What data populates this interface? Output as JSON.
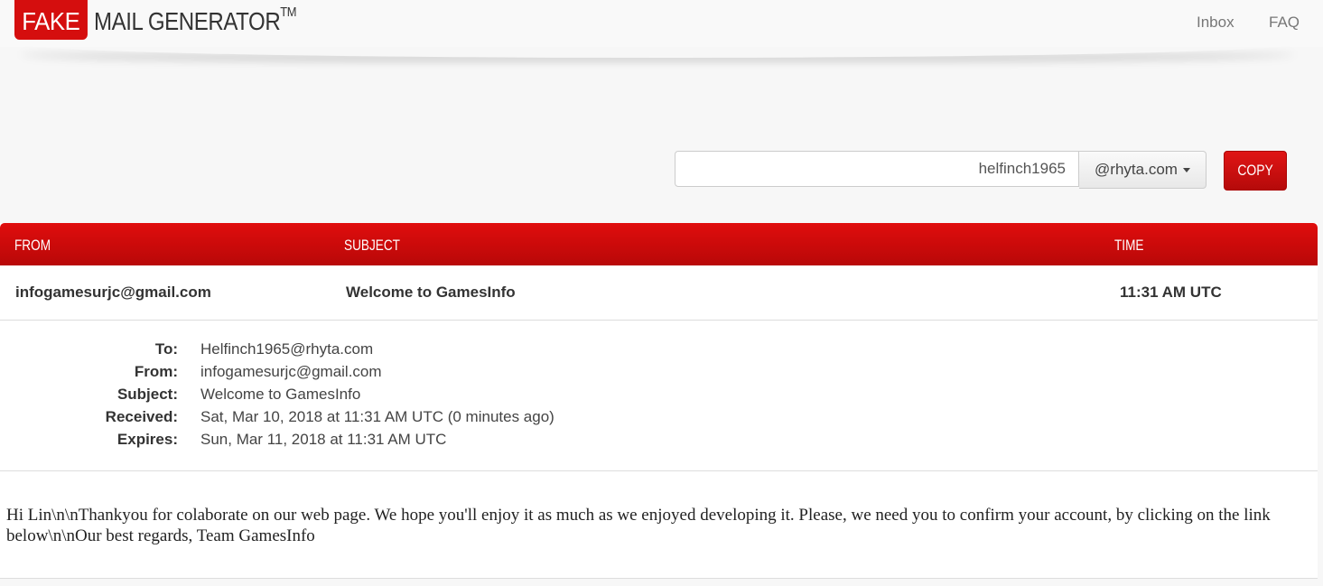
{
  "header": {
    "logo_fake": "FAKE",
    "logo_rest": "MAIL GENERATOR",
    "logo_tm": "TM",
    "nav": [
      "Inbox",
      "FAQ"
    ]
  },
  "address": {
    "username": "helfinch1965",
    "domain": "@rhyta.com",
    "copy_label": "COPY"
  },
  "table": {
    "columns": [
      "FROM",
      "SUBJECT",
      "TIME"
    ],
    "row": {
      "from": "infogamesurjc@gmail.com",
      "subject": "Welcome to GamesInfo",
      "time": "11:31 AM UTC"
    }
  },
  "message": {
    "fields": [
      {
        "label": "To:",
        "value": "Helfinch1965@rhyta.com"
      },
      {
        "label": "From:",
        "value": "infogamesurjc@gmail.com"
      },
      {
        "label": "Subject:",
        "value": "Welcome to GamesInfo"
      },
      {
        "label": "Received:",
        "value": "Sat, Mar 10, 2018 at 11:31 AM UTC (0 minutes ago)"
      },
      {
        "label": "Expires:",
        "value": "Sun, Mar 11, 2018 at 11:31 AM UTC"
      }
    ],
    "body": "Hi Lin\\n\\nThankyou for colaborate on our web page. We hope you'll enjoy it as much as we enjoyed developing it. Please, we need you to confirm your account, by clicking on the link below\\n\\nOur best regards, Team GamesInfo"
  },
  "colors": {
    "brand_red": "#d50e0e",
    "background": "#f7f7f7"
  }
}
